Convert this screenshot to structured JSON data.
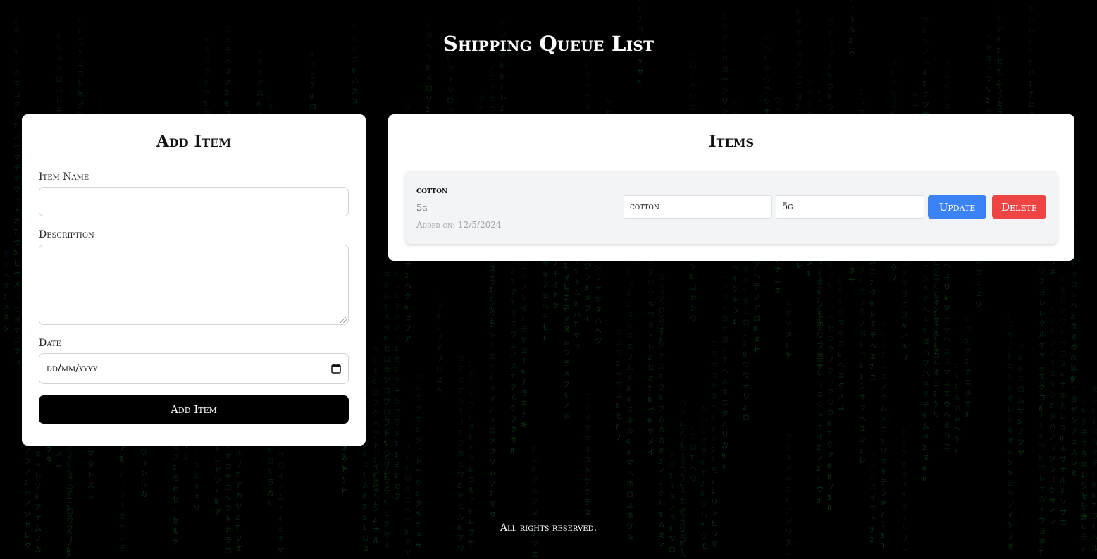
{
  "header": {
    "title": "Shipping Queue List"
  },
  "add_form": {
    "title": "Add Item",
    "item_name_label": "Item Name",
    "item_name_value": "",
    "description_label": "Description",
    "description_value": "",
    "date_label": "Date",
    "date_placeholder": "dd/mm/yyyy",
    "date_icon": "calendar-icon",
    "submit_label": "Add Item"
  },
  "items_panel": {
    "title": "Items",
    "items": [
      {
        "name": "cotton",
        "description": "5g",
        "added": "Added on: 12/5/2024",
        "edit_name_value": "cotton",
        "edit_description_value": "5g",
        "update_label": "Update",
        "delete_label": "Delete"
      }
    ]
  },
  "footer": {
    "text": "All rights reserved."
  },
  "colors": {
    "background": "#000000",
    "rain": "#1f6b2e",
    "update_button": "#3b82f6",
    "delete_button": "#ef4444",
    "primary_button": "#000000"
  }
}
